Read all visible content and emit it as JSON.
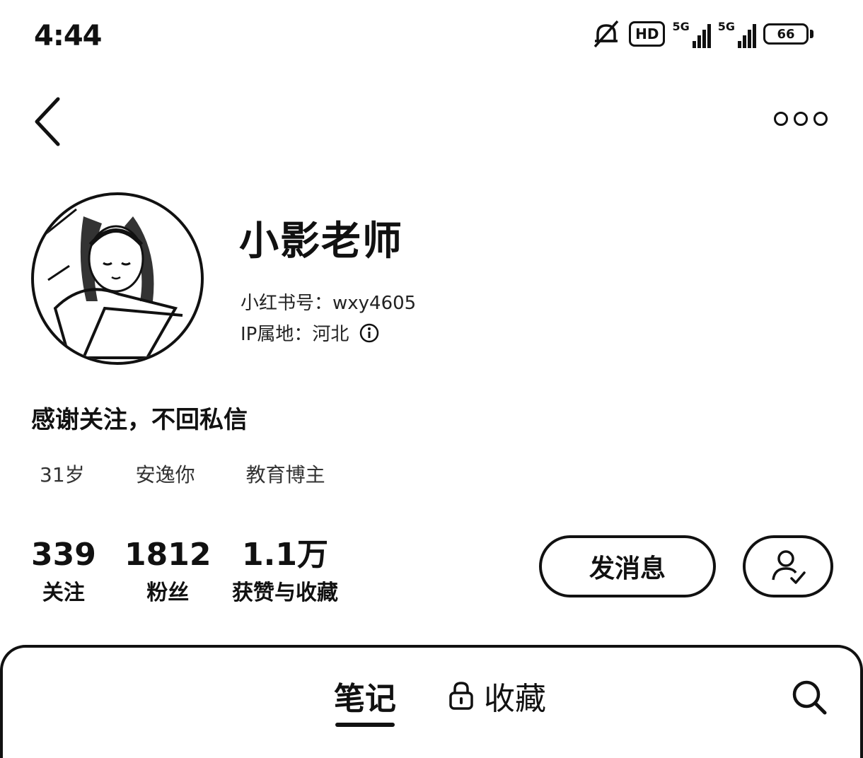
{
  "status_bar": {
    "time": "4:44",
    "hd_label": "HD",
    "net1_label": "5G",
    "net2_label": "5G",
    "battery_level": "66"
  },
  "profile": {
    "name": "小影老师",
    "uid_line": "小红书号：wxy4605",
    "location_line": "IP属地：河北",
    "bio": "感谢关注，不回私信",
    "tags": [
      "31岁",
      "安逸你",
      "教育博主"
    ]
  },
  "stats": {
    "following": {
      "value": "339",
      "label": "关注"
    },
    "followers": {
      "value": "1812",
      "label": "粉丝"
    },
    "likes": {
      "value": "1.1万",
      "label": "获赞与收藏"
    }
  },
  "actions": {
    "message_label": "发消息"
  },
  "tabs": {
    "notes_label": "笔记",
    "favorites_label": "收藏"
  },
  "icons": {
    "back": "chevron-left-icon",
    "more": "ellipsis-icon",
    "mute": "bell-off-icon",
    "add_friend": "user-plus-icon",
    "lock": "lock-icon",
    "search": "search-icon"
  }
}
